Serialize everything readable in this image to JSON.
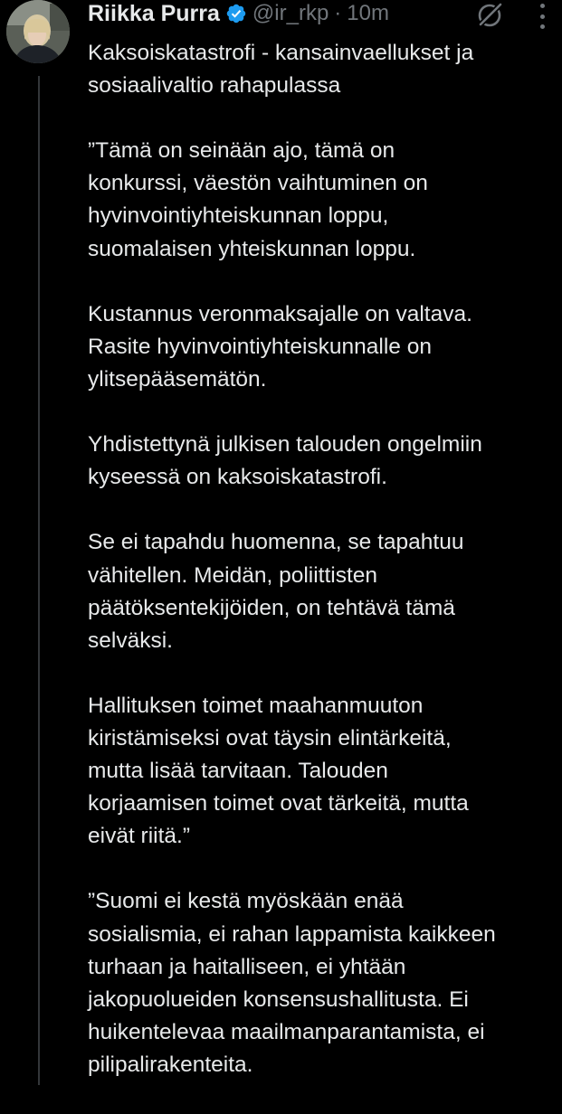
{
  "tweet": {
    "author_name": "Riikka Purra",
    "handle": "@ir_rkp",
    "separator": "·",
    "time": "10m",
    "verified": true,
    "accent_color": "#1d9bf0",
    "paragraphs": [
      "Kaksoiskatastrofi - kansainvaellukset ja\nsosiaalivaltio rahapulassa",
      "”Tämä on seinään ajo, tämä on\nkonkurssi, väestön vaihtuminen on\nhyvinvointiyhteiskunnan loppu,\nsuomalaisen yhteiskunnan loppu.",
      "Kustannus veronmaksajalle on valtava.\nRasite hyvinvointiyhteiskunnalle on\nylitsepääsemätön.",
      "Yhdistettynä julkisen talouden ongelmiin\nkyseessä on kaksoiskatastrofi.",
      "Se ei tapahdu huomenna, se tapahtuu\nvähitellen. Meidän, poliittisten\npäätöksentekijöiden, on tehtävä tämä\nselväksi.",
      "Hallituksen toimet maahanmuuton\nkiristämiseksi ovat täysin elintärkeitä,\nmutta lisää tarvitaan. Talouden\nkorjaamisen toimet ovat tärkeitä, mutta\neivät riitä.”",
      "”Suomi ei kestä myöskään enää\nsosialismia, ei rahan lappamista kaikkeen\nturhaan ja haitalliseen, ei yhtään\njakopuolueiden konsensushallitusta. Ei\nhuikentelevaa maailmanparantamista, ei\npilipalirakenteita."
    ]
  },
  "icons": {
    "verified": "verified-badge-icon",
    "grok": "grok-icon",
    "more": "more-options-icon"
  }
}
